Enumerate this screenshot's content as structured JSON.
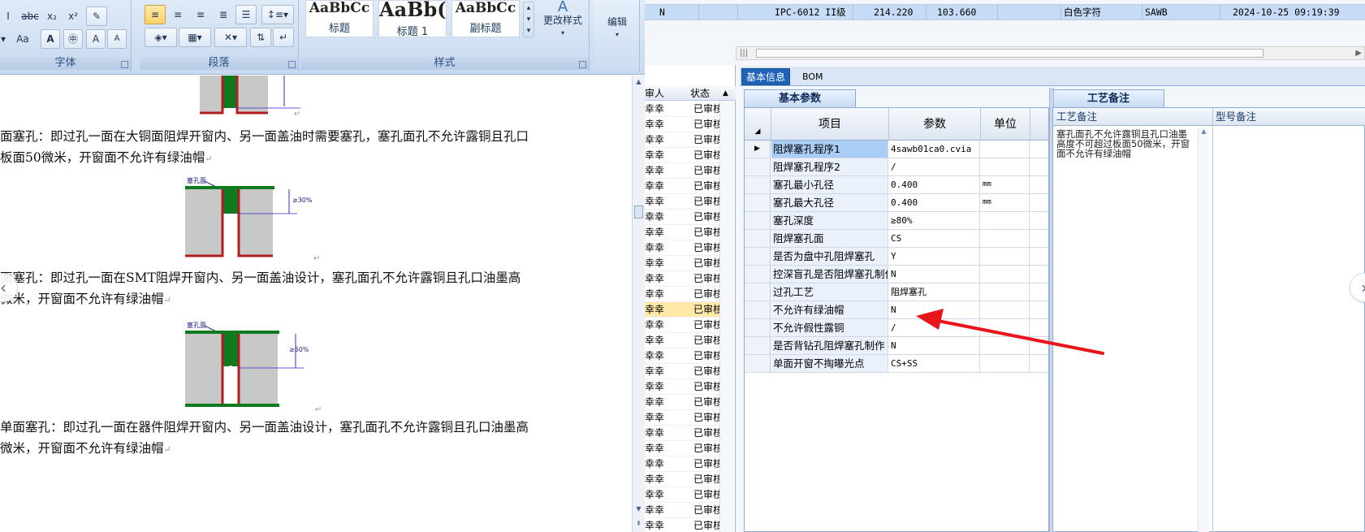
{
  "word": {
    "ribbon": {
      "font_group_label": "字体",
      "paragraph_group_label": "段落",
      "styles_group_label": "样式",
      "font_buttons": [
        "abc",
        "x₂",
        "x²",
        "Aa",
        "A",
        "A",
        "A",
        "A"
      ],
      "styles": [
        {
          "sample": "AaBbCc",
          "name": "标题"
        },
        {
          "sample": "AaBb(",
          "name": "标题 1"
        },
        {
          "sample": "AaBbCc",
          "name": "副标题"
        }
      ],
      "change_styles_label": "更改样式",
      "edit_label": "编辑"
    },
    "document": {
      "paragraphs": [
        {
          "line1": "面塞孔：即过孔一面在大铜面阻焊开窗内、另一面盖油时需要塞孔，塞孔面孔不允许露铜且孔口",
          "line2": "板面50微米，开窗面不允许有绿油帽"
        },
        {
          "line1": "面塞孔：即过孔一面在SMT阻焊开窗内、另一面盖油设计，塞孔面孔不允许露铜且孔口油墨高",
          "line2": "微米，开窗面不允许有绿油帽"
        },
        {
          "line1": "单面塞孔：即过孔一面在器件阻焊开窗内、另一面盖油设计，塞孔面孔不允许露铜且孔口油墨高",
          "line2": "微米，开窗面不允许有绿油帽"
        }
      ],
      "figure_labels": [
        "塞孔面",
        "≥30%",
        "塞孔面",
        "≥50%"
      ]
    }
  },
  "erp": {
    "top_row": {
      "flag": "N",
      "model": "IPC-6012 II级",
      "value1": "214.220",
      "value2": "103.660",
      "char_color": "白色字符",
      "code": "SAWB",
      "timestamp": "2024-10-25 09:19:39"
    },
    "list": {
      "headers": [
        "审人",
        "状态"
      ],
      "reviewer": "幸幸",
      "status": "已审核",
      "row_count": 28,
      "selected_index": 13
    },
    "tabs": [
      "基本信息",
      "BOM"
    ],
    "param_panel_title": "基本参数",
    "param_headers": [
      "项目",
      "参数",
      "单位"
    ],
    "params": [
      {
        "item": "阻焊塞孔程序1",
        "value": "4sawb01ca0.cvia",
        "unit": ""
      },
      {
        "item": "阻焊塞孔程序2",
        "value": "/",
        "unit": ""
      },
      {
        "item": "塞孔最小孔径",
        "value": "0.400",
        "unit": "mm"
      },
      {
        "item": "塞孔最大孔径",
        "value": "0.400",
        "unit": "mm"
      },
      {
        "item": "塞孔深度",
        "value": "≥80%",
        "unit": ""
      },
      {
        "item": "阻焊塞孔面",
        "value": "CS",
        "unit": ""
      },
      {
        "item": "是否为盘中孔阻焊塞孔",
        "value": "Y",
        "unit": ""
      },
      {
        "item": "控深盲孔是否阻焊塞孔制作",
        "value": "N",
        "unit": ""
      },
      {
        "item": "过孔工艺",
        "value": "阻焊塞孔",
        "unit": ""
      },
      {
        "item": "不允许有绿油帽",
        "value": "N",
        "unit": ""
      },
      {
        "item": "不允许假性露铜",
        "value": "/",
        "unit": ""
      },
      {
        "item": "是否背钻孔阻焊塞孔制作",
        "value": "N",
        "unit": ""
      },
      {
        "item": "单面开窗不掏曝光点",
        "value": "CS+SS",
        "unit": ""
      }
    ],
    "process_panel_title": "工艺备注",
    "process_headers": [
      "工艺备注",
      "型号备注"
    ],
    "process_note": "塞孔面孔不允许露铜且孔口油墨高度不可超过板面50微米，开窗面不允许有绿油帽"
  },
  "colors": {
    "selection_blue": "#c6dcf6",
    "row_highlight": "#ffe9a9",
    "tab_active": "#1f63b6",
    "annotation_arrow": "#e8161b"
  }
}
